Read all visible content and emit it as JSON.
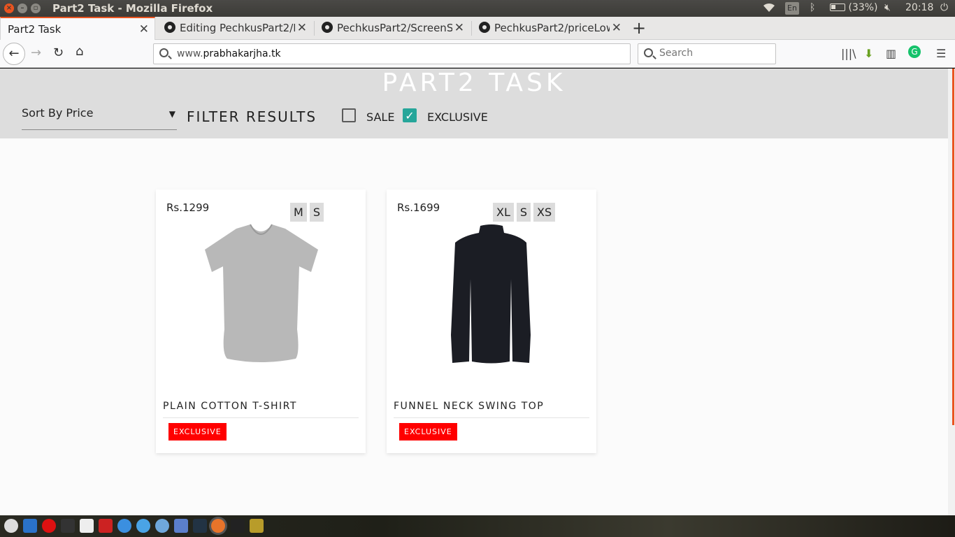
{
  "os": {
    "window_title": "Part2 Task - Mozilla Firefox",
    "lang_indicator": "En",
    "battery": "(33%)",
    "time": "20:18"
  },
  "browser": {
    "tabs": [
      {
        "label": "Part2 Task",
        "active": true
      },
      {
        "label": "Editing PechkusPart2/R",
        "active": false
      },
      {
        "label": "PechkusPart2/ScreenSh",
        "active": false
      },
      {
        "label": "PechkusPart2/priceLow",
        "active": false
      }
    ],
    "url_host": "www.",
    "url_domain": "prabhakarjha.tk",
    "search_placeholder": "Search"
  },
  "page": {
    "brand": "PART2 TASK",
    "sort_label": "Sort By Price",
    "filter_title": "FILTER RESULTS",
    "filters": [
      {
        "label": "SALE",
        "checked": false
      },
      {
        "label": "EXCLUSIVE",
        "checked": true
      }
    ],
    "products": [
      {
        "price": "Rs.1299",
        "sizes": [
          "M",
          "S"
        ],
        "name": "PLAIN COTTON T-SHIRT",
        "badge": "EXCLUSIVE",
        "image": "grey-tshirt"
      },
      {
        "price": "Rs.1699",
        "sizes": [
          "XL",
          "S",
          "XS"
        ],
        "name": "FUNNEL NECK SWING TOP",
        "badge": "EXCLUSIVE",
        "image": "black-swing-top"
      }
    ]
  },
  "colors": {
    "accent": "#e95420",
    "checkbox_on": "#26a69a",
    "badge": "#ff0000",
    "header_bg": "#dddddd"
  }
}
